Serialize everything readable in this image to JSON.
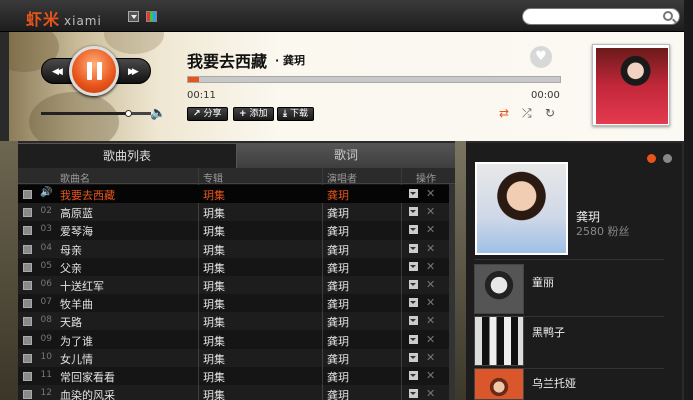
{
  "app": {
    "logo": "虾米",
    "logo_latin": "xiami"
  },
  "colors": {
    "accent": "#e8541a",
    "panel": "#1e1e1e"
  },
  "player": {
    "title": "我要去西藏",
    "artist": "· 龚玥",
    "time_current": "00:11",
    "time_total": "00:00",
    "progress": 0.03,
    "volume": 0.8,
    "buttons": {
      "share": "分享",
      "add": "添加",
      "download": "下载"
    },
    "icons": [
      "prev-icon",
      "pause-icon",
      "next-icon",
      "volume-icon",
      "heart-icon",
      "repeat-icon",
      "shuffle-icon",
      "single-loop-icon"
    ]
  },
  "tabs": {
    "playlist": "歌曲列表",
    "lyrics": "歌词"
  },
  "columns": {
    "name": "歌曲名",
    "album": "专辑",
    "artist": "演唱者",
    "actions": "操作"
  },
  "songs": [
    {
      "num": "",
      "name": "我要去西藏",
      "album": "玥集",
      "artist": "龚玥",
      "current": true
    },
    {
      "num": "02",
      "name": "高原蓝",
      "album": "玥集",
      "artist": "龚玥"
    },
    {
      "num": "03",
      "name": "爱琴海",
      "album": "玥集",
      "artist": "龚玥"
    },
    {
      "num": "04",
      "name": "母亲",
      "album": "玥集",
      "artist": "龚玥"
    },
    {
      "num": "05",
      "name": "父亲",
      "album": "玥集",
      "artist": "龚玥"
    },
    {
      "num": "06",
      "name": "十送红军",
      "album": "玥集",
      "artist": "龚玥"
    },
    {
      "num": "07",
      "name": "牧羊曲",
      "album": "玥集",
      "artist": "龚玥"
    },
    {
      "num": "08",
      "name": "天路",
      "album": "玥集",
      "artist": "龚玥"
    },
    {
      "num": "09",
      "name": "为了谁",
      "album": "玥集",
      "artist": "龚玥"
    },
    {
      "num": "10",
      "name": "女儿情",
      "album": "玥集",
      "artist": "龚玥"
    },
    {
      "num": "11",
      "name": "常回家看看",
      "album": "玥集",
      "artist": "龚玥"
    },
    {
      "num": "12",
      "name": "血染的风采",
      "album": "玥集",
      "artist": "龚玥"
    }
  ],
  "artist_panel": {
    "name": "龚玥",
    "fans": "2580 粉丝",
    "similar": [
      {
        "name": "童丽"
      },
      {
        "name": "黑鸭子"
      },
      {
        "name": "乌兰托娅"
      }
    ]
  }
}
